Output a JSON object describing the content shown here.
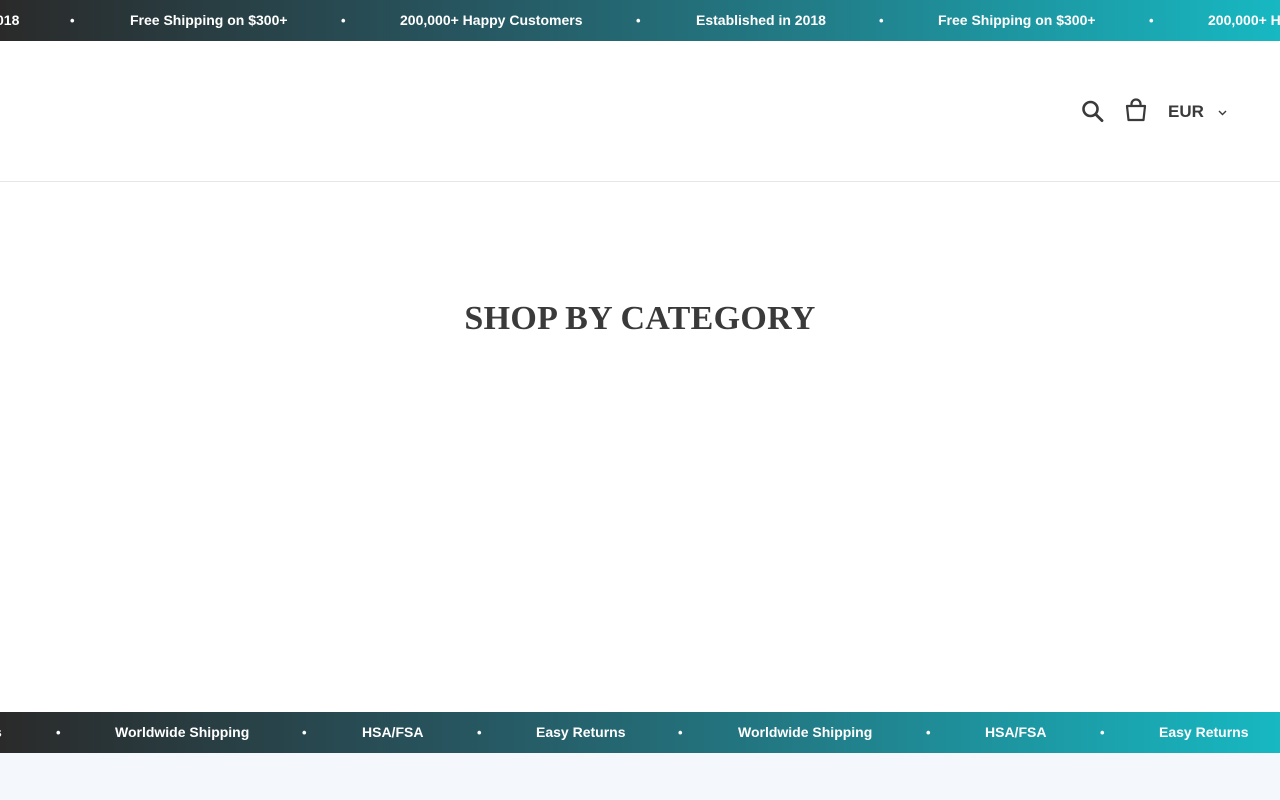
{
  "announcement_top": {
    "items": [
      "018",
      "Free Shipping on $300+",
      "200,000+ Happy Customers",
      "Established in 2018",
      "Free Shipping on $300+",
      "200,000+ H"
    ],
    "separator": "•"
  },
  "header": {
    "currency": "EUR",
    "icons": [
      "search-icon",
      "cart-icon",
      "chevron-down-icon"
    ]
  },
  "main": {
    "section_title": "SHOP BY CATEGORY"
  },
  "announcement_bottom": {
    "items": [
      "s",
      "Worldwide Shipping",
      "HSA/FSA",
      "Easy Returns",
      "Worldwide Shipping",
      "HSA/FSA",
      "Easy Returns"
    ],
    "separator": "•"
  }
}
